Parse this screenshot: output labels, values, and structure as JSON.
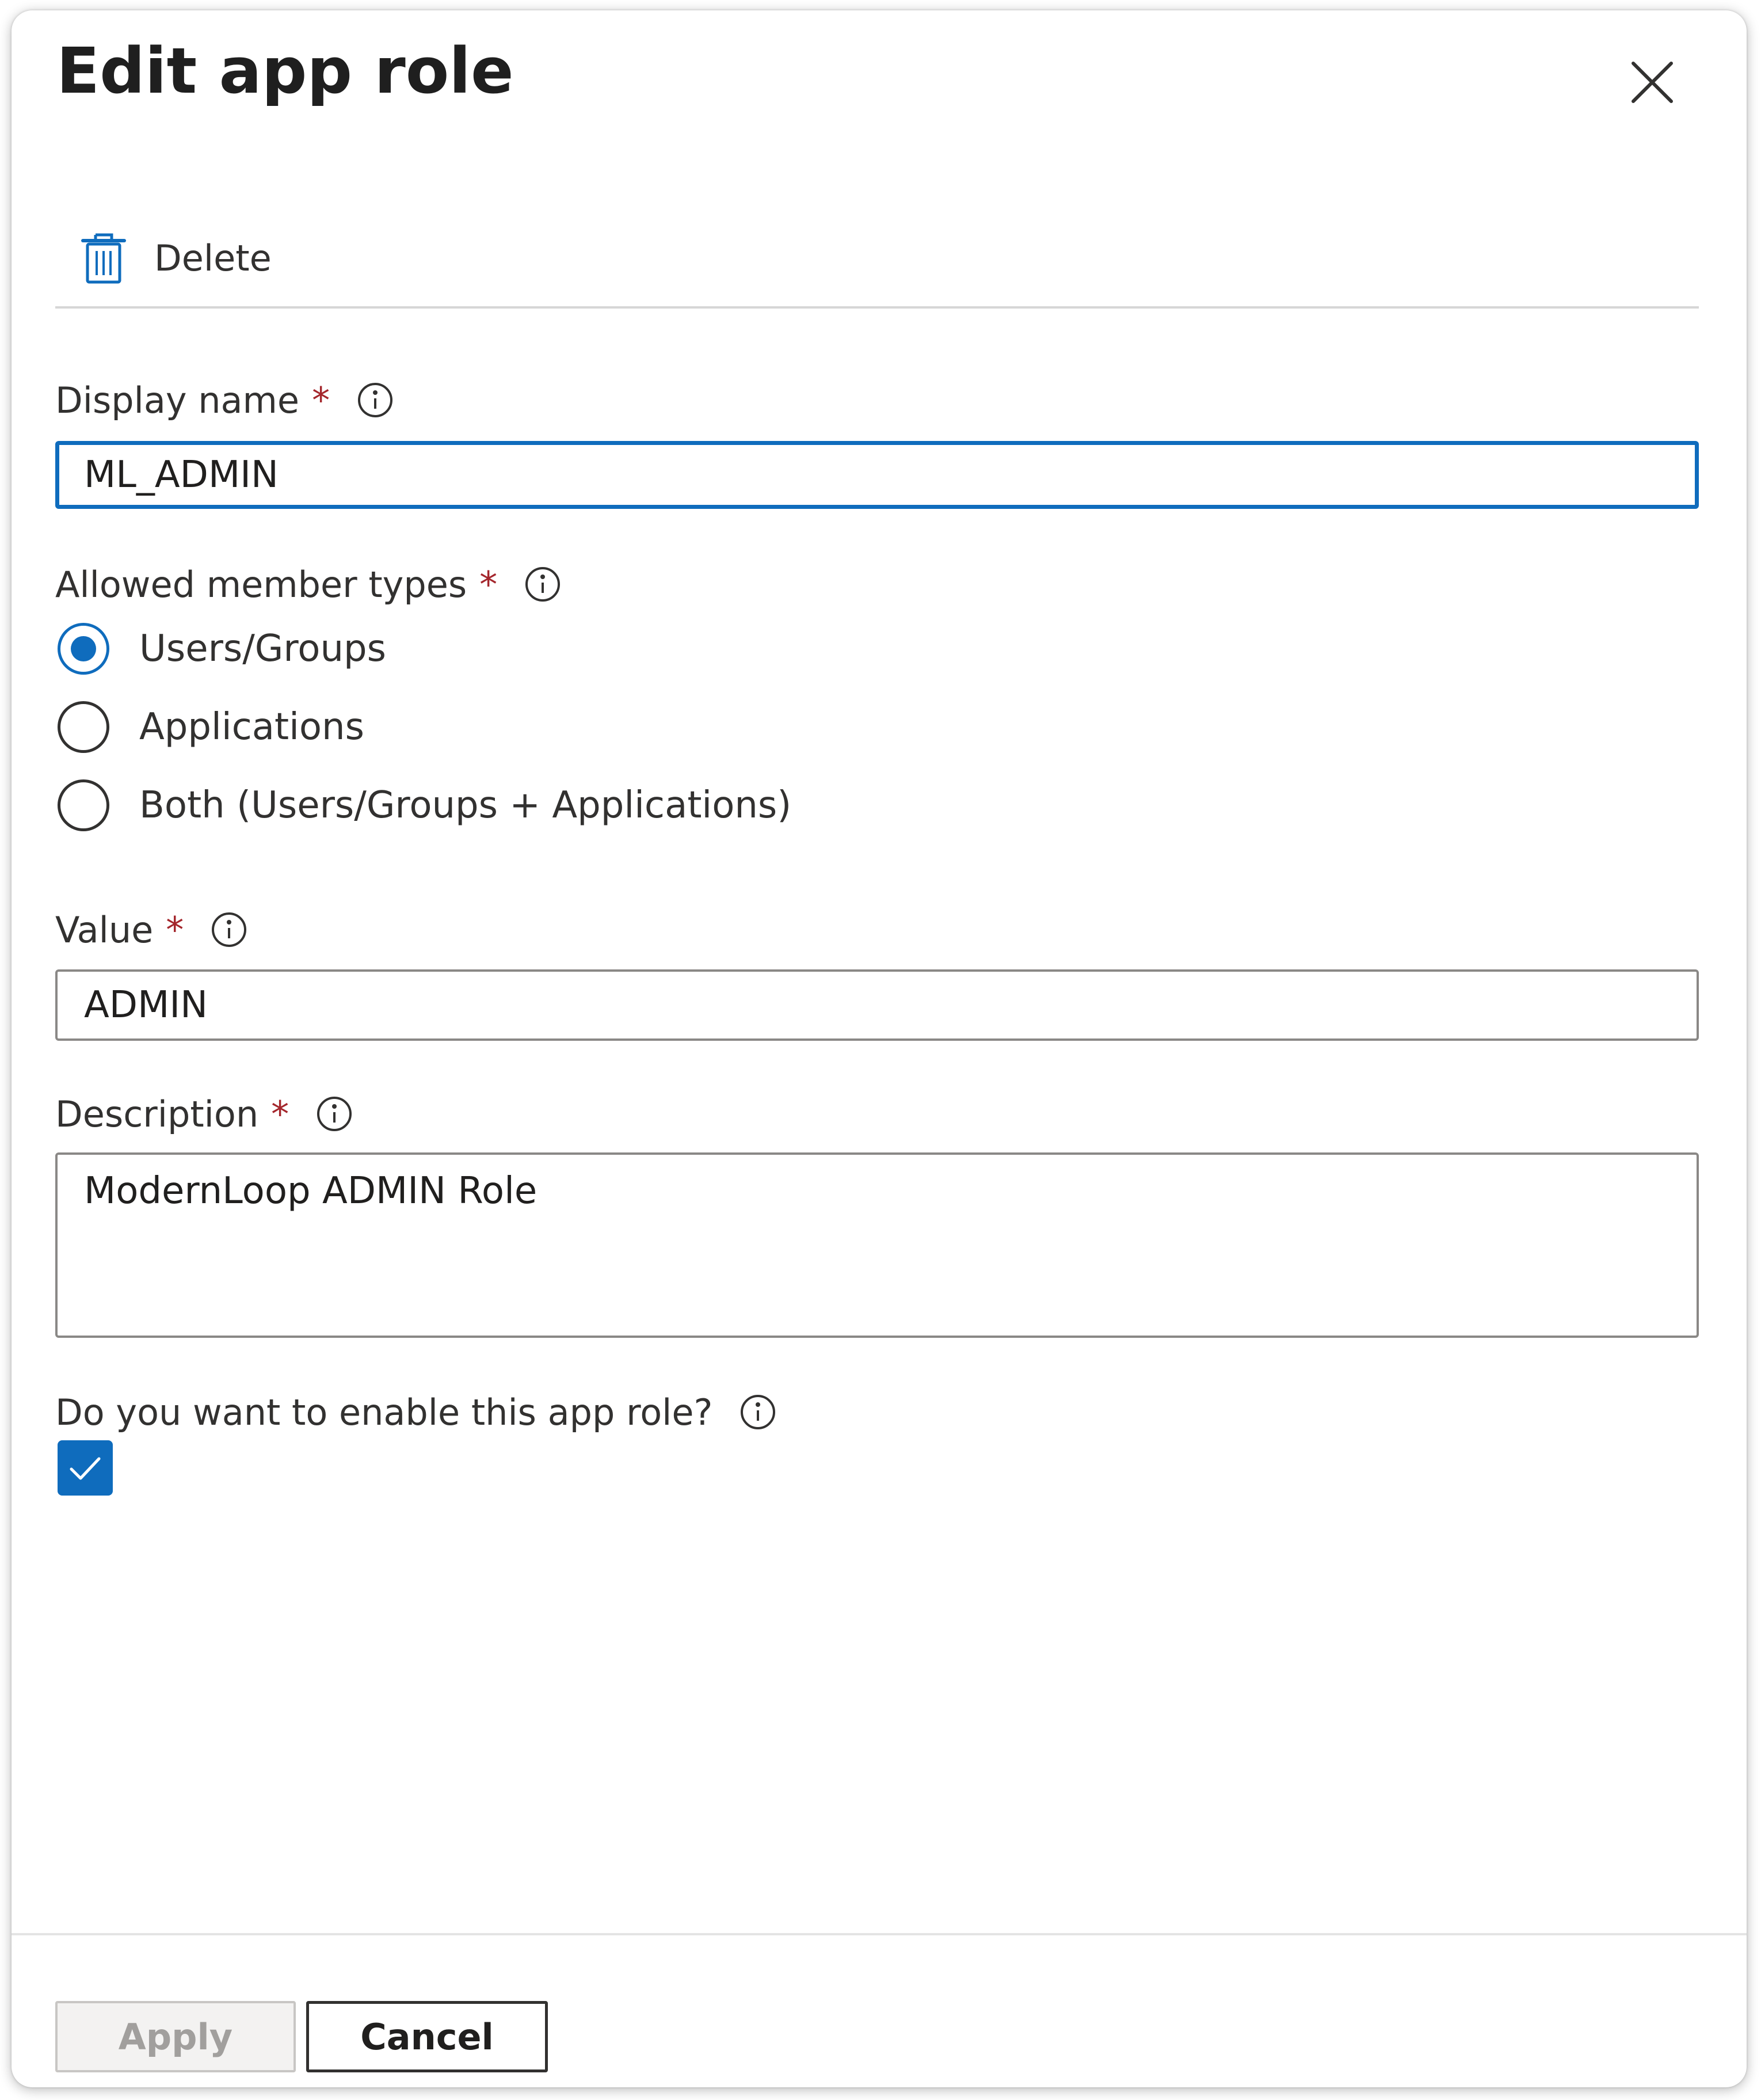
{
  "dialog": {
    "title": "Edit app role",
    "close_icon": "close-icon"
  },
  "toolbar": {
    "delete_label": "Delete",
    "delete_icon": "trash-icon"
  },
  "form": {
    "display_name": {
      "label": "Display name",
      "required_mark": "*",
      "value": "ML_ADMIN"
    },
    "member_types": {
      "label": "Allowed member types",
      "required_mark": "*",
      "options": [
        {
          "label": "Users/Groups",
          "selected": true
        },
        {
          "label": "Applications",
          "selected": false
        },
        {
          "label": "Both (Users/Groups + Applications)",
          "selected": false
        }
      ]
    },
    "value": {
      "label": "Value",
      "required_mark": "*",
      "value": "ADMIN"
    },
    "description": {
      "label": "Description",
      "required_mark": "*",
      "value": "ModernLoop ADMIN Role"
    },
    "enable": {
      "label": "Do you want to enable this app role?",
      "checked": true
    }
  },
  "footer": {
    "apply_label": "Apply",
    "cancel_label": "Cancel"
  },
  "colors": {
    "accent": "#0f6cbd",
    "required": "#a4262c",
    "text": "#323130"
  }
}
